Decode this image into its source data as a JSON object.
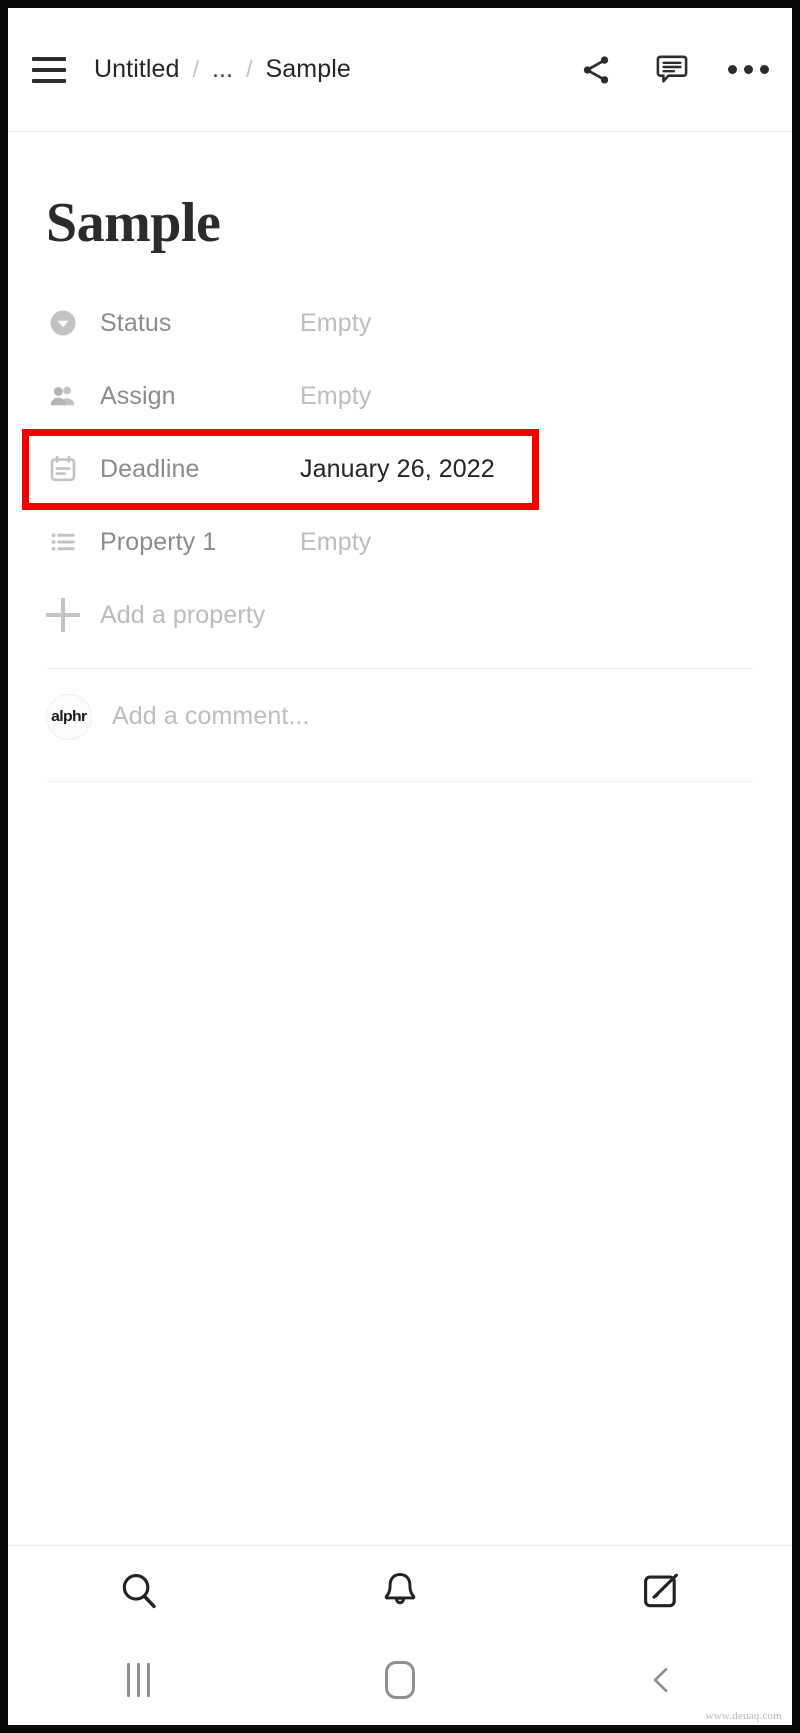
{
  "appbar": {
    "menu_icon": "hamburger-menu-icon",
    "breadcrumb": {
      "items": [
        "Untitled",
        "...",
        "Sample"
      ],
      "separator": "/"
    },
    "actions": [
      {
        "icon": "share-icon",
        "label": "Share"
      },
      {
        "icon": "comment-icon",
        "label": "Comments"
      },
      {
        "icon": "more-options-icon",
        "label": "More"
      }
    ]
  },
  "page": {
    "title": "Sample",
    "properties": [
      {
        "icon": "status-circle-chevron-icon",
        "label": "Status",
        "value": "Empty",
        "filled": false
      },
      {
        "icon": "people-icon",
        "label": "Assign",
        "value": "Empty",
        "filled": false
      },
      {
        "icon": "calendar-icon",
        "label": "Deadline",
        "value": "January 26, 2022",
        "filled": true
      },
      {
        "icon": "bulleted-list-icon",
        "label": "Property 1",
        "value": "Empty",
        "filled": false
      }
    ],
    "add_property_label": "Add a property",
    "add_property_icon": "plus-icon",
    "comment": {
      "avatar_text": "alphr",
      "placeholder": "Add a comment..."
    }
  },
  "highlight": {
    "target": "Deadline",
    "color": "#f50000"
  },
  "bottom_toolbar": [
    {
      "icon": "search-icon",
      "label": "Search"
    },
    {
      "icon": "bell-icon",
      "label": "Notifications"
    },
    {
      "icon": "compose-icon",
      "label": "New page"
    }
  ],
  "android_navbar": [
    {
      "icon": "recents-icon",
      "label": "Recents"
    },
    {
      "icon": "home-icon",
      "label": "Home"
    },
    {
      "icon": "back-icon",
      "label": "Back"
    }
  ],
  "watermark": "www.deuaq.com"
}
